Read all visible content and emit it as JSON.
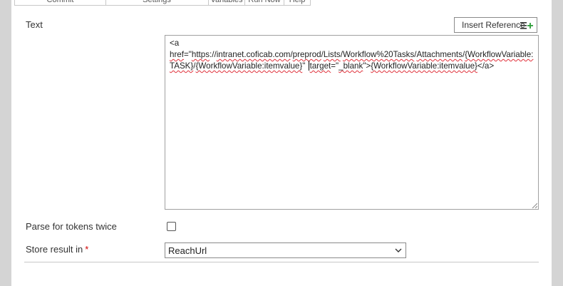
{
  "ribbon": {
    "tabs": [
      "Commit",
      "Settings",
      "Variables",
      "Run Now",
      "Help"
    ]
  },
  "text_field": {
    "label": "Text",
    "insert_reference_label": "Insert Reference",
    "content": {
      "p1": "<a ",
      "p2": "href",
      "p3": "=\"",
      "p4": "https",
      "p5": "://",
      "p6": "intranet.coficab.com",
      "p7": "/",
      "p8": "preprod",
      "p9": "/",
      "p10": "Lists",
      "p11": "/",
      "p12": "Workflow%20Tasks",
      "p13": "/",
      "p14": "Attachments",
      "p15": "/",
      "p16": "{WorkflowVariable:TASK}",
      "p17": "/",
      "p18": "{WorkflowVariable:itemvalue}",
      "p19": "\" ",
      "p20": "target",
      "p21": "=\"",
      "p22": "_blank",
      "p23": "\">",
      "p24": "{WorkflowVariable:itemvalue}",
      "p25": "</a>"
    }
  },
  "parse_tokens": {
    "label": "Parse for tokens twice",
    "checked": false
  },
  "store_result": {
    "label": "Store result in",
    "required_marker": "*",
    "selected_value": "ReachUrl"
  },
  "colors": {
    "required": "#d00000",
    "spellcheck": "#e0303a",
    "icon_accent": "#2e9e3a"
  },
  "icons": {
    "insert_reference": "insert-list-plus-icon",
    "select": "chevron-down-icon"
  }
}
